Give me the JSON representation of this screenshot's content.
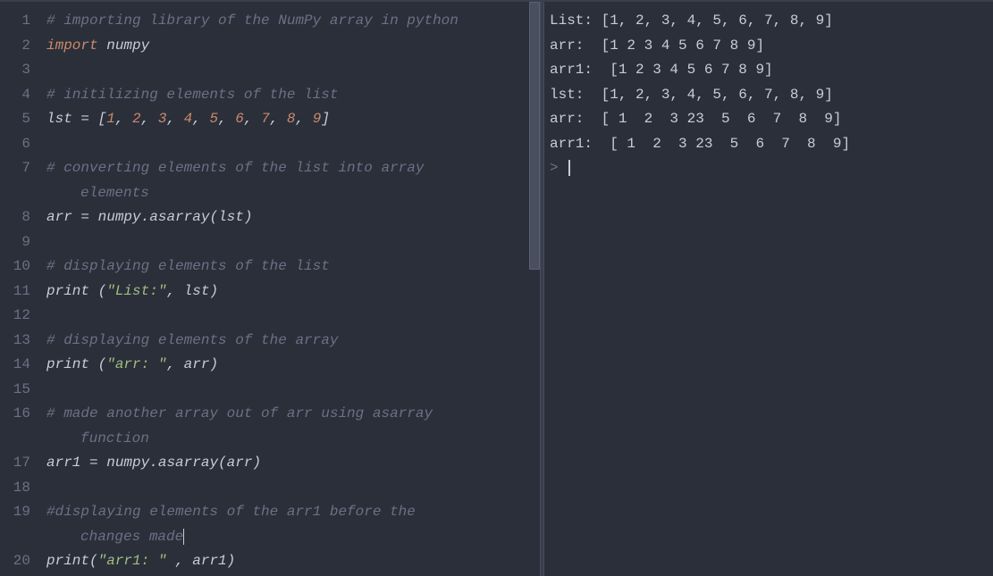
{
  "editor": {
    "gutter": [
      "1",
      "2",
      "3",
      "4",
      "5",
      "6",
      "7",
      "",
      "8",
      "9",
      "10",
      "11",
      "12",
      "13",
      "14",
      "15",
      "16",
      "",
      "17",
      "18",
      "19",
      "",
      "20"
    ],
    "lines": [
      {
        "t": "comment",
        "text": "# importing library of the NumPy array in python"
      },
      {
        "t": "code",
        "spans": [
          [
            "kw",
            "import"
          ],
          [
            "ident",
            " numpy"
          ]
        ]
      },
      {
        "t": "blank"
      },
      {
        "t": "comment",
        "text": "# initilizing elements of the list"
      },
      {
        "t": "code",
        "spans": [
          [
            "ident",
            "lst "
          ],
          [
            "op",
            "="
          ],
          [
            "punct",
            " ["
          ],
          [
            "num",
            "1"
          ],
          [
            "punct",
            ", "
          ],
          [
            "num",
            "2"
          ],
          [
            "punct",
            ", "
          ],
          [
            "num",
            "3"
          ],
          [
            "punct",
            ", "
          ],
          [
            "num",
            "4"
          ],
          [
            "punct",
            ", "
          ],
          [
            "num",
            "5"
          ],
          [
            "punct",
            ", "
          ],
          [
            "num",
            "6"
          ],
          [
            "punct",
            ", "
          ],
          [
            "num",
            "7"
          ],
          [
            "punct",
            ", "
          ],
          [
            "num",
            "8"
          ],
          [
            "punct",
            ", "
          ],
          [
            "num",
            "9"
          ],
          [
            "punct",
            "]"
          ]
        ]
      },
      {
        "t": "blank"
      },
      {
        "t": "comment",
        "text": "# converting elements of the list into array "
      },
      {
        "t": "comment-wrap",
        "text": "elements"
      },
      {
        "t": "code",
        "spans": [
          [
            "ident",
            "arr "
          ],
          [
            "op",
            "="
          ],
          [
            "ident",
            " numpy"
          ],
          [
            "punct",
            "."
          ],
          [
            "fn",
            "asarray"
          ],
          [
            "punct",
            "("
          ],
          [
            "ident",
            "lst"
          ],
          [
            "punct",
            ")"
          ]
        ]
      },
      {
        "t": "blank"
      },
      {
        "t": "comment",
        "text": "# displaying elements of the list"
      },
      {
        "t": "code",
        "spans": [
          [
            "fn",
            "print "
          ],
          [
            "punct",
            "("
          ],
          [
            "str",
            "\"List:\""
          ],
          [
            "punct",
            ", "
          ],
          [
            "ident",
            "lst"
          ],
          [
            "punct",
            ")"
          ]
        ]
      },
      {
        "t": "blank"
      },
      {
        "t": "comment",
        "text": "# displaying elements of the array"
      },
      {
        "t": "code",
        "spans": [
          [
            "fn",
            "print "
          ],
          [
            "punct",
            "("
          ],
          [
            "str",
            "\"arr: \""
          ],
          [
            "punct",
            ", "
          ],
          [
            "ident",
            "arr"
          ],
          [
            "punct",
            ")"
          ]
        ]
      },
      {
        "t": "blank"
      },
      {
        "t": "comment",
        "text": "# made another array out of arr using asarray "
      },
      {
        "t": "comment-wrap",
        "text": "function"
      },
      {
        "t": "code",
        "spans": [
          [
            "ident",
            "arr1 "
          ],
          [
            "op",
            "="
          ],
          [
            "ident",
            " numpy"
          ],
          [
            "punct",
            "."
          ],
          [
            "fn",
            "asarray"
          ],
          [
            "punct",
            "("
          ],
          [
            "ident",
            "arr"
          ],
          [
            "punct",
            ")"
          ]
        ]
      },
      {
        "t": "blank"
      },
      {
        "t": "comment",
        "text": "#displaying elements of the arr1 before the "
      },
      {
        "t": "comment-wrap-caret",
        "text": "changes made"
      },
      {
        "t": "code",
        "spans": [
          [
            "fn",
            "print"
          ],
          [
            "punct",
            "("
          ],
          [
            "str",
            "\"arr1: \""
          ],
          [
            "punct",
            " , "
          ],
          [
            "ident",
            "arr1"
          ],
          [
            "punct",
            ")"
          ]
        ]
      }
    ]
  },
  "output": {
    "lines": [
      "List: [1, 2, 3, 4, 5, 6, 7, 8, 9]",
      "arr:  [1 2 3 4 5 6 7 8 9]",
      "arr1:  [1 2 3 4 5 6 7 8 9]",
      "lst:  [1, 2, 3, 4, 5, 6, 7, 8, 9]",
      "arr:  [ 1  2  3 23  5  6  7  8  9]",
      "arr1:  [ 1  2  3 23  5  6  7  8  9]"
    ],
    "prompt": "> "
  }
}
